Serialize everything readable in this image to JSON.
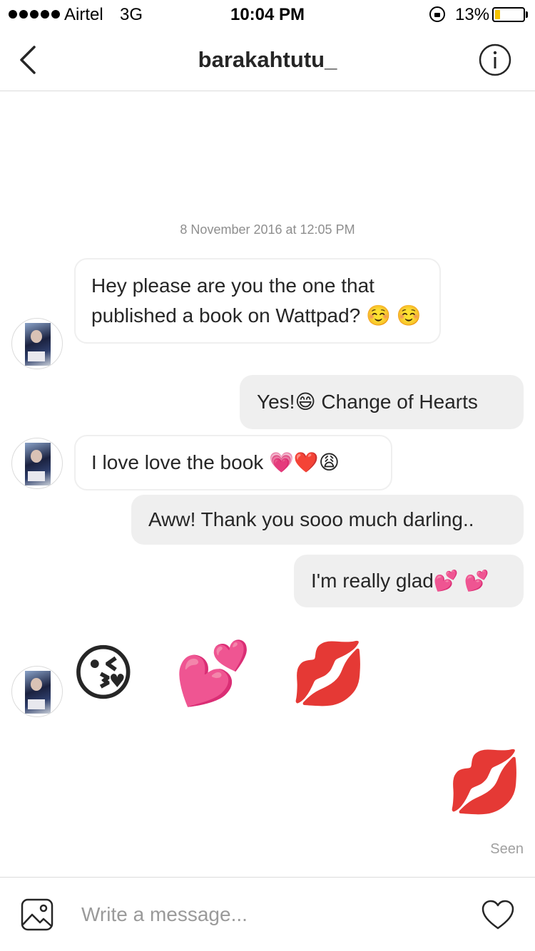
{
  "status_bar": {
    "carrier": "Airtel",
    "network": "3G",
    "time": "10:04 PM",
    "battery": "13%",
    "battery_level": 0.13
  },
  "header": {
    "title": "barakahtutu_",
    "back_icon": "chevron-left-icon",
    "info_icon": "info-icon"
  },
  "conversation": {
    "timestamp": "8 November 2016 at 12:05 PM",
    "messages": [
      {
        "from": "them",
        "text": "Hey please are you the one that published a book on Wattpad? ☺️ ☺️"
      },
      {
        "from": "me",
        "text": "Yes!😄 Change of Hearts"
      },
      {
        "from": "them",
        "text": "I love love the book 💗❤️😩"
      },
      {
        "from": "me",
        "text": "Aww! Thank you sooo much darling.."
      },
      {
        "from": "me",
        "text": "I'm really glad💕 💕"
      },
      {
        "from": "them",
        "text": "😘 💕 💋"
      },
      {
        "from": "me",
        "text": "💋"
      }
    ],
    "seen_label": "Seen"
  },
  "composer": {
    "placeholder": "Write a message...",
    "gallery_icon": "image-icon",
    "like_icon": "heart-icon"
  },
  "colors": {
    "incoming_bubble_bg": "#ffffff",
    "incoming_bubble_border": "#efefef",
    "outgoing_bubble_bg": "#efefef",
    "text": "#262626",
    "muted": "#8e8e8e",
    "battery_fill": "#f5c400"
  }
}
